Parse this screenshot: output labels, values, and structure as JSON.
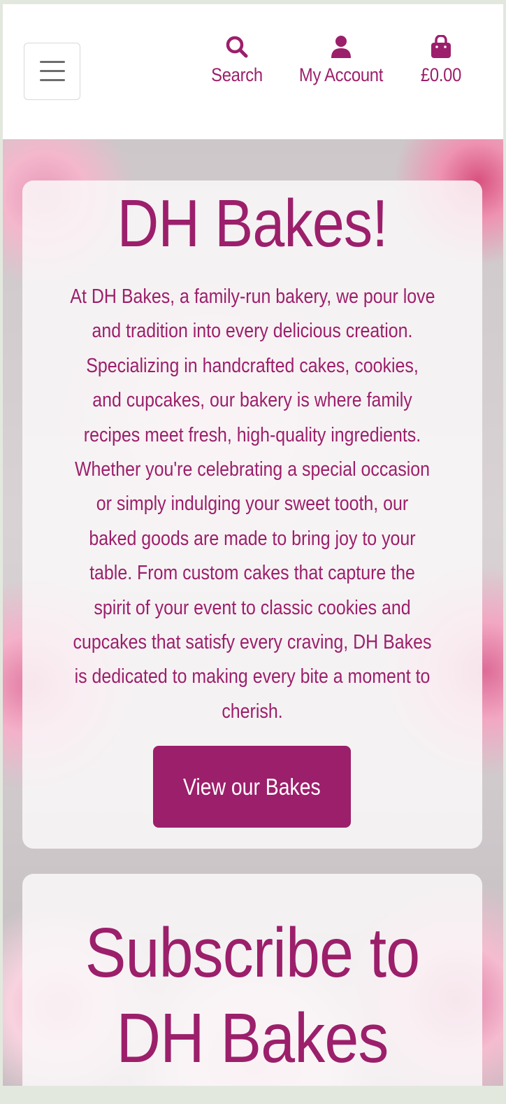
{
  "header": {
    "menu_toggle": "Toggle navigation",
    "search_label": "Search",
    "account_label": "My Account",
    "cart_label": "£0.00",
    "icons": {
      "menu": "hamburger-icon",
      "search": "search-icon",
      "account": "user-icon",
      "cart": "shopping-bag-icon"
    }
  },
  "hero": {
    "title": "DH Bakes!",
    "intro_lines": [
      "At DH Bakes, a family-run bakery, we pour love",
      "and tradition into every delicious creation.",
      "Specializing in handcrafted cakes, cookies,",
      "and cupcakes, our bakery is where family",
      "recipes meet fresh, high-quality ingredients.",
      "Whether you're celebrating a special occasion",
      "or simply indulging your sweet tooth, our",
      "baked goods are made to bring joy to your",
      "table. From custom cakes that capture the",
      "spirit of your event to classic cookies and",
      "cupcakes that satisfy every craving, DH Bakes",
      "is dedicated to making every bite a moment to",
      "cherish."
    ],
    "cta_label": "View our Bakes"
  },
  "subscribe": {
    "title_lines": [
      "Subscribe to",
      "DH Bakes"
    ]
  },
  "colors": {
    "brand": "#9c1f6b",
    "card_bg": "#faf8f9",
    "button_text": "#ffffff"
  }
}
